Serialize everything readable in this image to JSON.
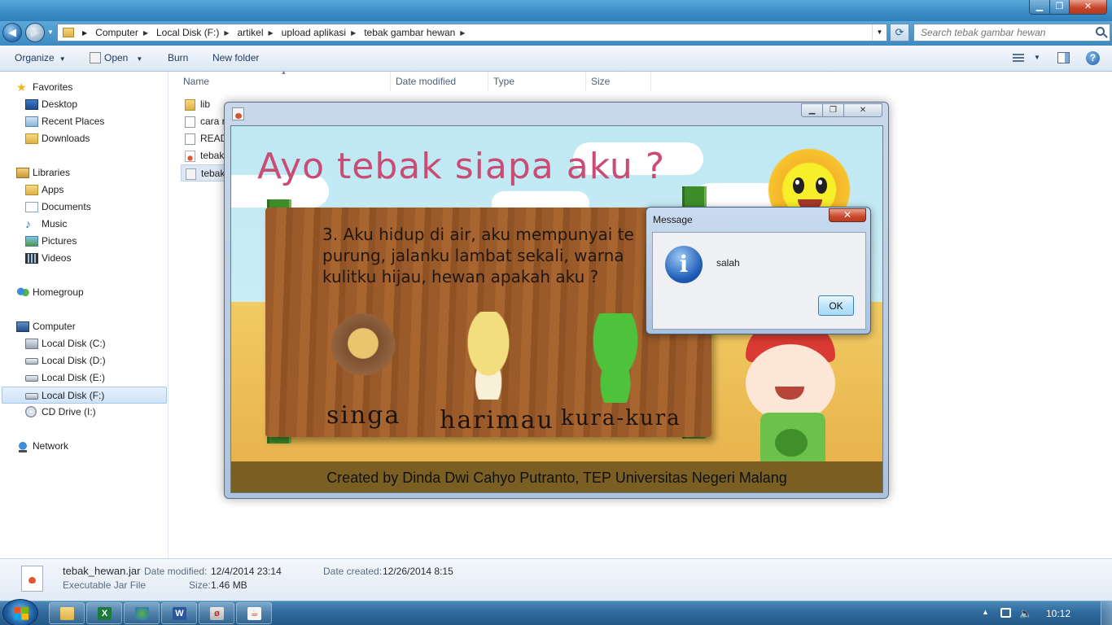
{
  "explorer": {
    "breadcrumbs": [
      "Computer",
      "Local Disk (F:)",
      "artikel",
      "upload aplikasi",
      "tebak gambar hewan"
    ],
    "search_placeholder": "Search tebak gambar hewan",
    "toolbar": {
      "organize": "Organize",
      "open": "Open",
      "burn": "Burn",
      "new_folder": "New folder"
    },
    "nav": {
      "favorites": "Favorites",
      "desktop": "Desktop",
      "recent_places": "Recent Places",
      "downloads": "Downloads",
      "libraries": "Libraries",
      "apps": "Apps",
      "documents": "Documents",
      "music": "Music",
      "pictures": "Pictures",
      "videos": "Videos",
      "homegroup": "Homegroup",
      "computer": "Computer",
      "drive_c": "Local Disk (C:)",
      "drive_d": "Local Disk (D:)",
      "drive_e": "Local Disk (E:)",
      "drive_f": "Local Disk (F:)",
      "drive_i": "CD Drive (I:)",
      "network": "Network"
    },
    "columns": {
      "name": "Name",
      "date_modified": "Date modified",
      "type": "Type",
      "size": "Size"
    },
    "files": [
      "lib",
      "cara r",
      "READ",
      "tebak",
      "tebak"
    ],
    "details": {
      "filename": "tebak_hewan.jar",
      "filetype": "Executable Jar File",
      "date_modified_label": "Date modified:",
      "date_modified_value": "12/4/2014 23:14",
      "size_label": "Size:",
      "size_value": "1.46 MB",
      "date_created_label": "Date created:",
      "date_created_value": "12/26/2014 8:15"
    }
  },
  "app": {
    "title": "Ayo tebak siapa aku ?",
    "question": "3. Aku hidup di air, aku mempunyai te purung, jalanku lambat sekali, warna kulitku hijau, hewan apakah aku ?",
    "options": [
      "singa",
      "harimau",
      "kura-kura"
    ],
    "footer": "Created by Dinda Dwi Cahyo Putranto, TEP Universitas Negeri Malang"
  },
  "dialog": {
    "title": "Message",
    "message": "salah",
    "ok": "OK",
    "close_glyph": "✕"
  },
  "taskbar": {
    "time": "10:12"
  }
}
